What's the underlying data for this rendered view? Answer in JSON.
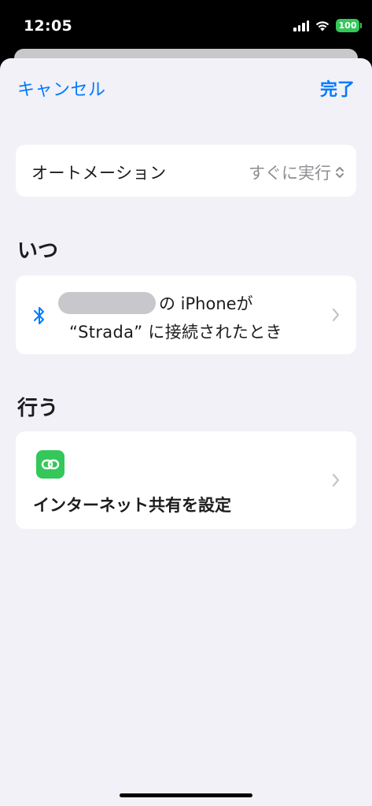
{
  "status_bar": {
    "time": "12:05",
    "battery": "100",
    "icons": [
      "signal-icon",
      "wifi-icon",
      "battery-icon"
    ]
  },
  "nav": {
    "cancel": "キャンセル",
    "done": "完了"
  },
  "automation_row": {
    "label": "オートメーション",
    "value": "すぐに実行"
  },
  "when_section": {
    "header": "いつ",
    "trigger_line1_suffix": "の iPhoneが",
    "trigger_line2": "“Strada” に接続されたとき",
    "icon": "bluetooth-icon"
  },
  "do_section": {
    "header": "行う",
    "action_label": "インターネット共有を設定",
    "icon": "link-icon"
  },
  "colors": {
    "accent": "#007aff",
    "action_icon_bg": "#34c759",
    "battery": "#34c759",
    "background": "#f2f1f7"
  }
}
